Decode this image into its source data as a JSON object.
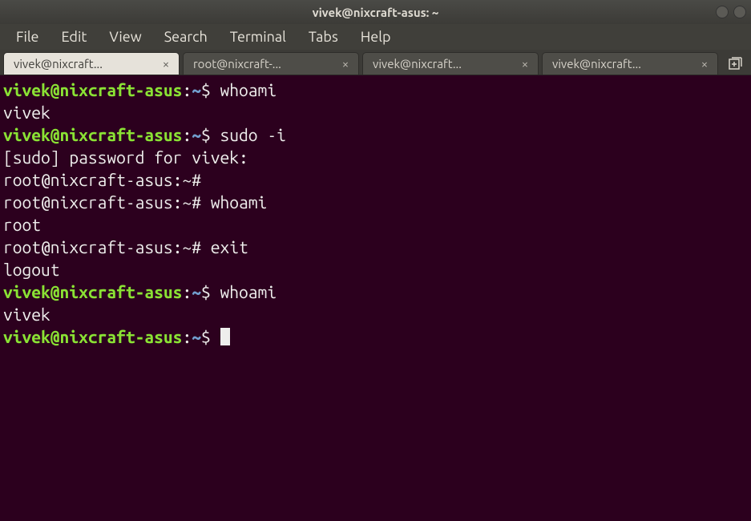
{
  "window": {
    "title": "vivek@nixcraft-asus: ~"
  },
  "menu": {
    "items": [
      "File",
      "Edit",
      "View",
      "Search",
      "Terminal",
      "Tabs",
      "Help"
    ]
  },
  "tabs": [
    {
      "label": "vivek@nixcraft...",
      "active": true
    },
    {
      "label": "root@nixcraft-...",
      "active": false
    },
    {
      "label": "vivek@nixcraft...",
      "active": false
    },
    {
      "label": "vivek@nixcraft...",
      "active": false
    }
  ],
  "terminal": {
    "lines": [
      {
        "type": "prompt_user",
        "user": "vivek",
        "host": "nixcraft-asus",
        "path": "~",
        "symbol": "$",
        "command": "whoami"
      },
      {
        "type": "output",
        "text": "vivek"
      },
      {
        "type": "prompt_user",
        "user": "vivek",
        "host": "nixcraft-asus",
        "path": "~",
        "symbol": "$",
        "command": "sudo -i"
      },
      {
        "type": "output",
        "text": "[sudo] password for vivek:"
      },
      {
        "type": "output",
        "text": "root@nixcraft-asus:~#"
      },
      {
        "type": "output_with_cmd",
        "prefix": "root@nixcraft-asus:~#",
        "command": "whoami"
      },
      {
        "type": "output",
        "text": "root"
      },
      {
        "type": "output_with_cmd",
        "prefix": "root@nixcraft-asus:~#",
        "command": "exit"
      },
      {
        "type": "output",
        "text": "logout"
      },
      {
        "type": "prompt_user",
        "user": "vivek",
        "host": "nixcraft-asus",
        "path": "~",
        "symbol": "$",
        "command": "whoami"
      },
      {
        "type": "output",
        "text": "vivek"
      },
      {
        "type": "prompt_user_cursor",
        "user": "vivek",
        "host": "nixcraft-asus",
        "path": "~",
        "symbol": "$"
      }
    ]
  }
}
